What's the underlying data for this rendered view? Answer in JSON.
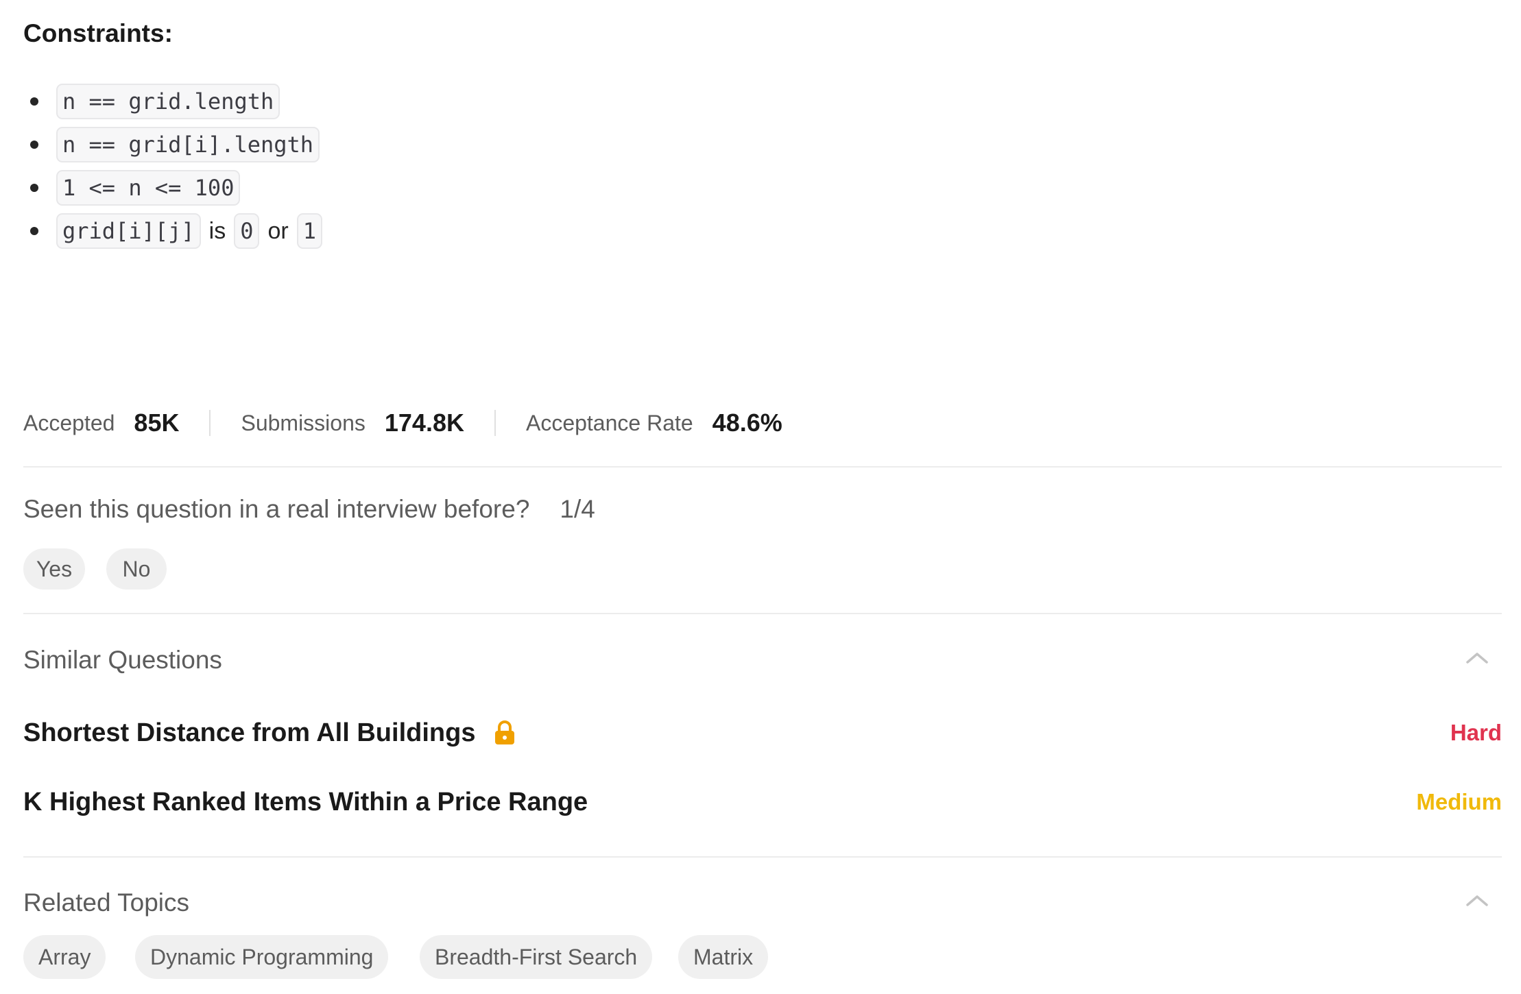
{
  "constraints": {
    "heading": "Constraints:",
    "items": [
      {
        "code1": "n == grid.length"
      },
      {
        "code1": "n == grid[i].length"
      },
      {
        "code1": "1 <= n <= 100"
      },
      {
        "code1": "grid[i][j]",
        "word1": "is",
        "code2": "0",
        "word2": "or",
        "code3": "1"
      }
    ]
  },
  "stats": {
    "accepted_label": "Accepted",
    "accepted_value": "85K",
    "submissions_label": "Submissions",
    "submissions_value": "174.8K",
    "rate_label": "Acceptance Rate",
    "rate_value": "48.6%"
  },
  "interview": {
    "question": "Seen this question in a real interview before?",
    "count": "1/4",
    "yes_label": "Yes",
    "no_label": "No"
  },
  "similar": {
    "title": "Similar Questions",
    "items": [
      {
        "title": "Shortest Distance from All Buildings",
        "difficulty": "Hard",
        "locked": true
      },
      {
        "title": "K Highest Ranked Items Within a Price Range",
        "difficulty": "Medium",
        "locked": false
      }
    ]
  },
  "topics": {
    "title": "Related Topics",
    "items": [
      "Array",
      "Dynamic Programming",
      "Breadth-First Search",
      "Matrix"
    ]
  },
  "colors": {
    "hard": "#e0334f",
    "medium": "#f0b90b",
    "lock": "#f0a000"
  },
  "icons": {
    "lock": "lock-icon",
    "collapse": "chevron-up-icon"
  }
}
